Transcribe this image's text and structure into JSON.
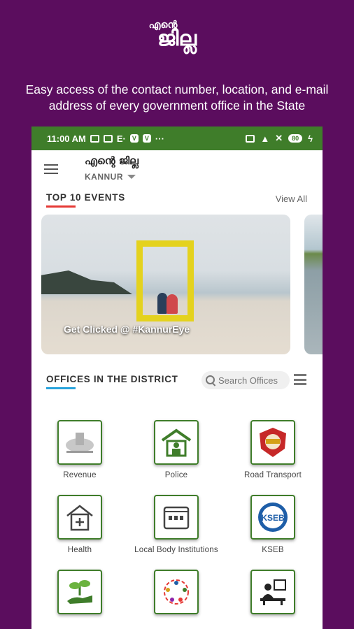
{
  "promo": {
    "logo_line1": "എന്റെ",
    "logo_line2": "ജില്ല",
    "tagline": "Easy access of the contact number, location, and e-mail address of every government office in the State"
  },
  "status_bar": {
    "time": "11:00 AM",
    "battery": "80"
  },
  "app_bar": {
    "title": "എന്റെ ജില്ല",
    "district": "KANNUR"
  },
  "events": {
    "heading": "TOP 10 EVENTS",
    "view_all": "View All",
    "cards": [
      {
        "caption": "Get Clicked @ #KannurEye"
      }
    ]
  },
  "offices": {
    "heading": "OFFICES IN THE DISTRICT",
    "search_placeholder": "Search Offices",
    "items": [
      {
        "label": "Revenue",
        "icon": "emblem-icon"
      },
      {
        "label": "Police",
        "icon": "police-station-icon"
      },
      {
        "label": "Road Transport",
        "icon": "mvd-badge-icon"
      },
      {
        "label": "Health",
        "icon": "hospital-icon"
      },
      {
        "label": "Local Body Institutions",
        "icon": "building-icon"
      },
      {
        "label": "KSEB",
        "icon": "kseb-logo-icon"
      },
      {
        "label": "",
        "icon": "plant-hand-icon"
      },
      {
        "label": "",
        "icon": "people-circle-icon"
      },
      {
        "label": "",
        "icon": "teacher-desk-icon"
      }
    ]
  },
  "colors": {
    "background": "#5b0d5e",
    "status_bar": "#3f7d2a",
    "accent_red": "#e53935",
    "accent_blue": "#29a3dc"
  }
}
